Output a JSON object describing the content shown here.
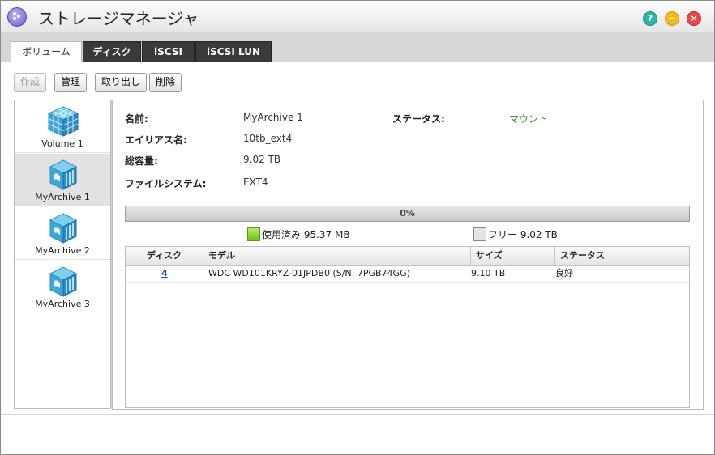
{
  "window": {
    "title": "ストレージマネージャ"
  },
  "title_controls": {
    "help": "?",
    "minimize": "−",
    "close": "×"
  },
  "tabs": [
    "ボリューム",
    "ディスク",
    "iSCSI",
    "iSCSI LUN"
  ],
  "toolbar": {
    "create": "作成",
    "manage": "管理",
    "eject": "取り出し",
    "delete": "削除"
  },
  "volumes": [
    {
      "name": "Volume 1",
      "icon": "cube-icon"
    },
    {
      "name": "MyArchive 1",
      "icon": "archive-icon"
    },
    {
      "name": "MyArchive 2",
      "icon": "archive-icon"
    },
    {
      "name": "MyArchive 3",
      "icon": "archive-icon"
    }
  ],
  "details": {
    "name_label": "名前:",
    "name_value": "MyArchive 1",
    "status_label": "ステータス:",
    "status_value": "マウント",
    "alias_label": "エイリアス名:",
    "alias_value": "10tb_ext4",
    "capacity_label": "総容量:",
    "capacity_value": "9.02 TB",
    "fs_label": "ファイルシステム:",
    "fs_value": "EXT4"
  },
  "usage": {
    "percent_label": "0%",
    "used_fraction": 0.0,
    "used_label": "使用済み 95.37 MB",
    "free_label": "フリー 9.02 TB"
  },
  "disk_table": {
    "headers": [
      "ディスク",
      "モデル",
      "サイズ",
      "ステータス"
    ],
    "rows": [
      {
        "disk": "4",
        "model": "WDC WD101KRYZ-01JPDB0 (S/N: 7PGB74GG)",
        "size": "9.10 TB",
        "status": "良好"
      }
    ]
  },
  "colors": {
    "accent": "#6b60c9",
    "mount": "#2d8a1e",
    "link": "#1f3fc2"
  }
}
